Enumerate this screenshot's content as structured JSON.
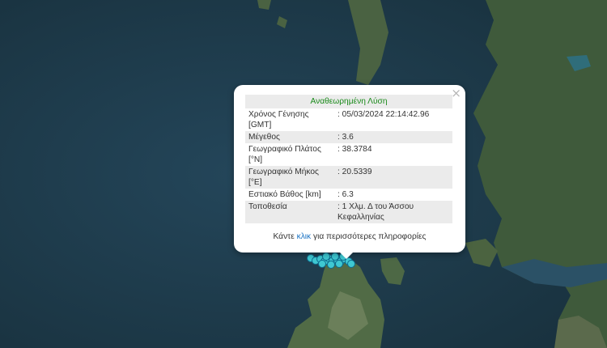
{
  "popup": {
    "title": "Αναθεωρημένη Λύση",
    "close_symbol": "×",
    "rows": [
      {
        "label": "Χρόνος Γένησης [GMT]",
        "value": ": 05/03/2024 22:14:42.96"
      },
      {
        "label": "Μέγεθος",
        "value": ": 3.6"
      },
      {
        "label": "Γεωγραφικό Πλάτος [°N]",
        "value": ": 38.3784"
      },
      {
        "label": "Γεωγραφικό Μήκος [°E]",
        "value": ": 20.5339"
      },
      {
        "label": "Εστιακό Βάθος [km]",
        "value": ": 6.3"
      },
      {
        "label": "Τοποθεσία",
        "value": ": 1 Χλμ. Δ του Άσσου Κεφαλληνίας"
      }
    ],
    "footer_before": "Κάντε",
    "footer_link": "κλικ",
    "footer_after": "για περισσότερες πληροφορίες"
  },
  "map": {
    "sea_color": "#1d3a4c",
    "land_color": "#3f5a3b",
    "marker_color": "#3fc8d2",
    "marker_edge": "#0e6c8e"
  }
}
